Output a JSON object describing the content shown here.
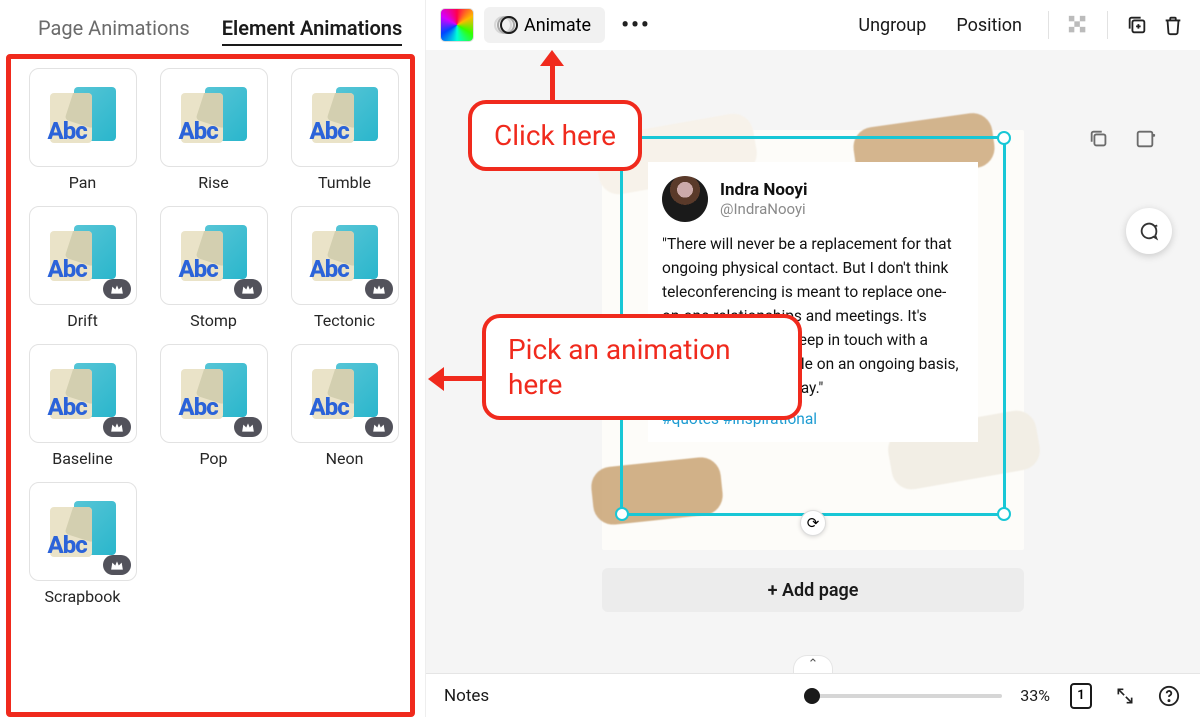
{
  "tabs": {
    "page_animations": "Page Animations",
    "element_animations": "Element Animations"
  },
  "thumb_text": "Abc",
  "animations": [
    {
      "label": "Pan",
      "premium": false
    },
    {
      "label": "Rise",
      "premium": false
    },
    {
      "label": "Tumble",
      "premium": false
    },
    {
      "label": "Drift",
      "premium": true
    },
    {
      "label": "Stomp",
      "premium": true
    },
    {
      "label": "Tectonic",
      "premium": true
    },
    {
      "label": "Baseline",
      "premium": true
    },
    {
      "label": "Pop",
      "premium": true
    },
    {
      "label": "Neon",
      "premium": true
    },
    {
      "label": "Scrapbook",
      "premium": true
    }
  ],
  "toolbar": {
    "animate": "Animate",
    "ungroup": "Ungroup",
    "position": "Position"
  },
  "tweet": {
    "name": "Indra Nooyi",
    "handle": "@IndraNooyi",
    "body": "\"There will never be a replacement for that ongoing physical contact. But I don't think teleconferencing is meant to replace one-on-one relationships and meetings. It's meant as a way to keep in touch with a broad range of people on an ongoing basis, in a more efficient way.\"",
    "tags": "#quotes #inspirational"
  },
  "add_page": "+ Add page",
  "bottom": {
    "notes": "Notes",
    "zoom_pct": "33%",
    "page_num": "1"
  },
  "annotations": {
    "click_here": "Click here",
    "pick_here": "Pick an animation here"
  }
}
